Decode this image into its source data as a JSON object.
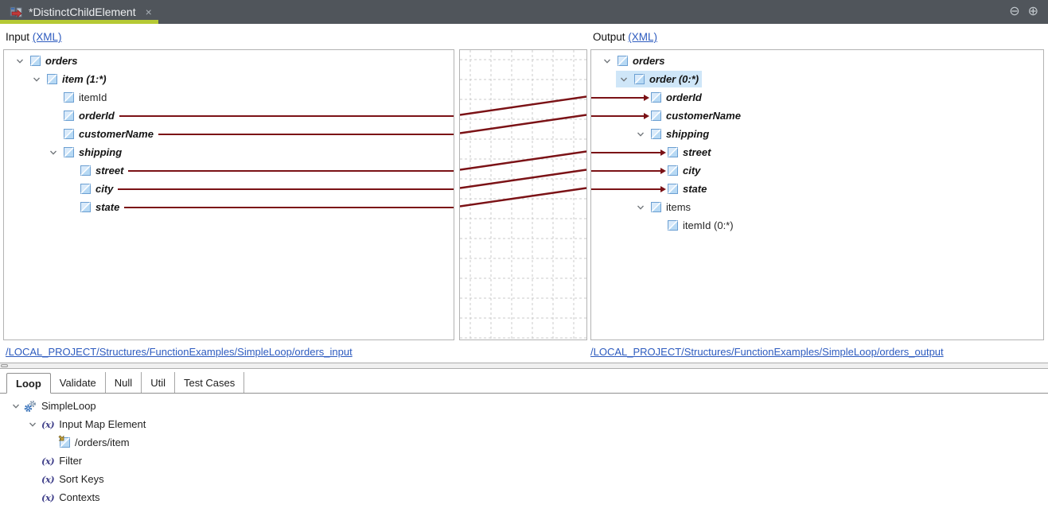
{
  "titlebar": {
    "tab_title": "*DistinctChildElement",
    "close_glyph": "×",
    "minimize_glyph": "⊖",
    "maximize_glyph": "⊕"
  },
  "colors": {
    "accent_underline": "#b5c934",
    "wire": "#7b1216",
    "link_blue": "#2d5bbf",
    "selection": "#cfe6f8",
    "grid": "#cbcbcb"
  },
  "input_panel": {
    "header_label": "Input",
    "header_link": "(XML)",
    "path_link": "/LOCAL_PROJECT/Structures/FunctionExamples/SimpleLoop/orders_input",
    "tree": [
      {
        "label": "orders",
        "level": 0,
        "chevron": true,
        "mapped": true,
        "wire": false
      },
      {
        "label": "item (1:*)",
        "level": 1,
        "chevron": true,
        "mapped": true,
        "wire": false
      },
      {
        "label": "itemId",
        "level": 2,
        "chevron": false,
        "mapped": false,
        "wire": false
      },
      {
        "label": "orderId",
        "level": 2,
        "chevron": false,
        "mapped": true,
        "wire": true
      },
      {
        "label": "customerName",
        "level": 2,
        "chevron": false,
        "mapped": true,
        "wire": true
      },
      {
        "label": "shipping",
        "level": 2,
        "chevron": true,
        "mapped": true,
        "wire": false
      },
      {
        "label": "street",
        "level": 3,
        "chevron": false,
        "mapped": true,
        "wire": true
      },
      {
        "label": "city",
        "level": 3,
        "chevron": false,
        "mapped": true,
        "wire": true
      },
      {
        "label": "state",
        "level": 3,
        "chevron": false,
        "mapped": true,
        "wire": true
      }
    ]
  },
  "output_panel": {
    "header_label": "Output",
    "header_link": "(XML)",
    "path_link": "/LOCAL_PROJECT/Structures/FunctionExamples/SimpleLoop/orders_output",
    "tree": [
      {
        "label": "orders",
        "level": 0,
        "chevron": true,
        "mapped": true,
        "arrow": false
      },
      {
        "label": "order (0:*)",
        "level": 1,
        "chevron": true,
        "mapped": true,
        "arrow": false,
        "selected": true
      },
      {
        "label": "orderId",
        "level": 2,
        "chevron": false,
        "mapped": true,
        "arrow": true
      },
      {
        "label": "customerName",
        "level": 2,
        "chevron": false,
        "mapped": true,
        "arrow": true
      },
      {
        "label": "shipping",
        "level": 2,
        "chevron": true,
        "mapped": true,
        "arrow": false
      },
      {
        "label": "street",
        "level": 3,
        "chevron": false,
        "mapped": true,
        "arrow": true
      },
      {
        "label": "city",
        "level": 3,
        "chevron": false,
        "mapped": true,
        "arrow": true
      },
      {
        "label": "state",
        "level": 3,
        "chevron": false,
        "mapped": true,
        "arrow": true
      },
      {
        "label": "items",
        "level": 2,
        "chevron": true,
        "mapped": false,
        "arrow": false
      },
      {
        "label": "itemId (0:*)",
        "level": 3,
        "chevron": false,
        "mapped": false,
        "arrow": false
      }
    ]
  },
  "connections": [
    {
      "from_row": 3,
      "to_row": 2
    },
    {
      "from_row": 4,
      "to_row": 3
    },
    {
      "from_row": 6,
      "to_row": 5
    },
    {
      "from_row": 7,
      "to_row": 6
    },
    {
      "from_row": 8,
      "to_row": 7
    }
  ],
  "function_section": {
    "tabs": [
      {
        "label": "Loop",
        "active": true
      },
      {
        "label": "Validate",
        "active": false
      },
      {
        "label": "Null",
        "active": false
      },
      {
        "label": "Util",
        "active": false
      },
      {
        "label": "Test Cases",
        "active": false
      }
    ],
    "tree": [
      {
        "label": "SimpleLoop",
        "level": 0,
        "chevron": true,
        "icon": "gears-icon"
      },
      {
        "label": "Input Map Element",
        "level": 1,
        "chevron": true,
        "icon": "xpath-function-icon"
      },
      {
        "label": "/orders/item",
        "level": 2,
        "chevron": false,
        "icon": "element-reference-icon"
      },
      {
        "label": "Filter",
        "level": 1,
        "chevron": false,
        "icon": "xpath-function-icon"
      },
      {
        "label": "Sort Keys",
        "level": 1,
        "chevron": false,
        "icon": "xpath-function-icon"
      },
      {
        "label": "Contexts",
        "level": 1,
        "chevron": false,
        "icon": "xpath-function-icon"
      }
    ],
    "xpath_glyph": "(x)"
  }
}
